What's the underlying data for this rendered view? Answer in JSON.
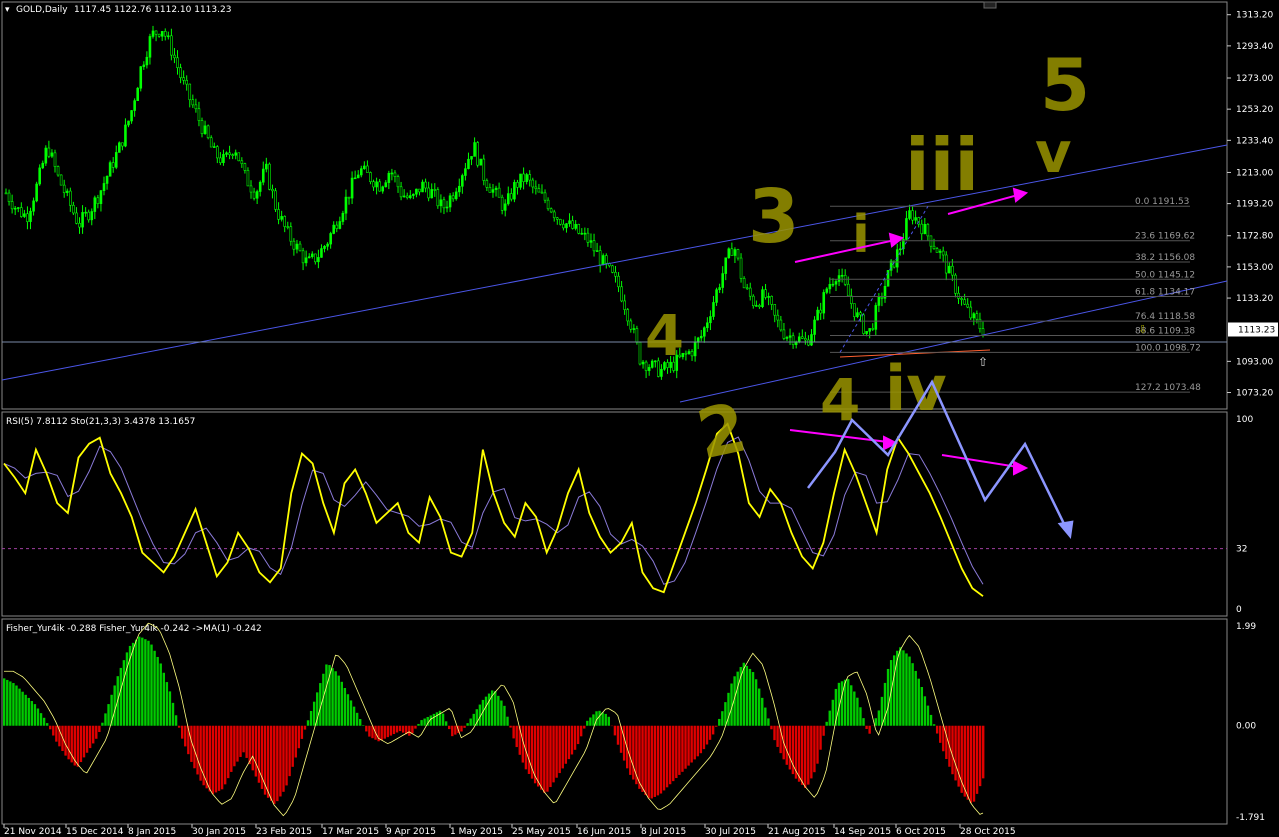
{
  "window": {
    "title": "GOLD,Daily",
    "ohlc": "1117.45 1122.76 1112.10 1113.23"
  },
  "colors": {
    "background": "#000000",
    "bull": "#00ff00",
    "bear": "#ff0000",
    "rsi": "#ffff00",
    "stoch": "#8a7ad8",
    "trendline": "#4b56e8",
    "annotation": "#9a9400",
    "arrow_magenta": "#ff00ff",
    "arrow_blue": "#8c96ff"
  },
  "price_axis": {
    "ticks": [
      "1313.20",
      "1293.40",
      "1273.00",
      "1253.20",
      "1233.40",
      "1213.00",
      "1193.20",
      "1172.80",
      "1153.00",
      "1133.20",
      "1113.23",
      "1093.00",
      "1073.20"
    ],
    "current": "1113.23"
  },
  "rsi_panel": {
    "label": "RSI(5) 7.8112  Sto(21,3,3) 3.4378 13.1657",
    "ticks": [
      "100",
      "32",
      "0"
    ]
  },
  "fisher_panel": {
    "label": "Fisher_Yur4ik -0.288  Fisher_Yur4ik -0.242  ->MA(1) -0.242",
    "ticks": [
      "1.99",
      "0.00",
      "-1.791"
    ]
  },
  "x_axis": {
    "labels": [
      "21 Nov 2014",
      "15 Dec 2014",
      "8 Jan 2015",
      "30 Jan 2015",
      "23 Feb 2015",
      "17 Mar 2015",
      "9 Apr 2015",
      "1 May 2015",
      "25 May 2015",
      "16 Jun 2015",
      "8 Jul 2015",
      "30 Jul 2015",
      "21 Aug 2015",
      "14 Sep 2015",
      "6 Oct 2015",
      "28 Oct 2015"
    ]
  },
  "fibonacci": [
    {
      "label": "0.0  1191.53"
    },
    {
      "label": "23.6  1169.62"
    },
    {
      "label": "38.2  1156.08"
    },
    {
      "label": "50.0  1145.12"
    },
    {
      "label": "61.8  1134.17"
    },
    {
      "label": "76.4  1118.58"
    },
    {
      "label": "88.6  1109.38"
    },
    {
      "label": "100.0  1098.72"
    },
    {
      "label": "127.2  1073.48"
    }
  ],
  "annotations": [
    "3",
    "i",
    "iii",
    "5",
    "v",
    "4",
    "2",
    "4",
    "iv"
  ],
  "chart_data": {
    "type": "candlestick",
    "title": "GOLD,Daily",
    "ylim": [
      1064,
      1320
    ],
    "x_labels": [
      "21 Nov 2014",
      "15 Dec 2014",
      "8 Jan 2015",
      "30 Jan 2015",
      "23 Feb 2015",
      "17 Mar 2015",
      "9 Apr 2015",
      "1 May 2015",
      "25 May 2015",
      "16 Jun 2015",
      "8 Jul 2015",
      "30 Jul 2015",
      "21 Aug 2015",
      "14 Sep 2015",
      "6 Oct 2015",
      "28 Oct 2015"
    ],
    "close_path": [
      1200,
      1190,
      1185,
      1205,
      1230,
      1210,
      1195,
      1180,
      1188,
      1200,
      1215,
      1230,
      1250,
      1280,
      1300,
      1305,
      1290,
      1270,
      1255,
      1240,
      1225,
      1220,
      1230,
      1210,
      1200,
      1215,
      1190,
      1175,
      1165,
      1155,
      1160,
      1170,
      1185,
      1200,
      1215,
      1210,
      1205,
      1215,
      1200,
      1195,
      1205,
      1200,
      1190,
      1200,
      1215,
      1230,
      1210,
      1200,
      1190,
      1205,
      1210,
      1200,
      1195,
      1185,
      1180,
      1175,
      1170,
      1160,
      1150,
      1140,
      1120,
      1095,
      1090,
      1087,
      1090,
      1095,
      1100,
      1110,
      1130,
      1150,
      1168,
      1140,
      1130,
      1135,
      1120,
      1110,
      1108,
      1105,
      1120,
      1140,
      1150,
      1135,
      1120,
      1110,
      1130,
      1150,
      1165,
      1188,
      1180,
      1170,
      1160,
      1145,
      1130,
      1120,
      1113
    ],
    "last": {
      "open": 1117.45,
      "high": 1122.76,
      "low": 1112.1,
      "close": 1113.23
    },
    "rsi_ylim": [
      0,
      100
    ],
    "rsi_level": 32,
    "rsi_last": 7.8112,
    "stoch_last": [
      3.4378,
      13.1657
    ],
    "fisher_ylim": [
      -1.791,
      1.99
    ],
    "fisher_last": [
      -0.288,
      -0.242
    ],
    "fisher_hist": [
      0.9,
      0.8,
      0.6,
      0.4,
      0.1,
      -0.3,
      -0.6,
      -0.8,
      -0.5,
      -0.2,
      0.4,
      1.0,
      1.5,
      1.7,
      1.6,
      1.2,
      0.6,
      -0.2,
      -0.7,
      -1.1,
      -1.3,
      -1.2,
      -0.8,
      -0.5,
      -0.9,
      -1.3,
      -1.5,
      -1.2,
      -0.6,
      0.0,
      0.6,
      1.2,
      1.0,
      0.6,
      0.2,
      -0.2,
      -0.3,
      -0.2,
      -0.1,
      -0.2,
      0.1,
      0.2,
      0.3,
      -0.2,
      -0.1,
      0.2,
      0.5,
      0.7,
      0.4,
      -0.3,
      -0.8,
      -1.1,
      -1.3,
      -1.0,
      -0.7,
      -0.4,
      0.1,
      0.3,
      0.2,
      -0.4,
      -0.9,
      -1.2,
      -1.4,
      -1.3,
      -1.1,
      -0.9,
      -0.7,
      -0.5,
      -0.2,
      0.3,
      0.9,
      1.2,
      1.0,
      0.4,
      -0.3,
      -0.7,
      -1.0,
      -1.2,
      -0.8,
      0.1,
      0.8,
      0.9,
      0.5,
      -0.2,
      0.3,
      1.2,
      1.5,
      1.3,
      0.8,
      0.2,
      -0.4,
      -0.9,
      -1.3,
      -1.5,
      -1.0
    ],
    "rsi_path": [
      75,
      68,
      60,
      82,
      70,
      55,
      50,
      78,
      85,
      88,
      70,
      60,
      48,
      30,
      25,
      20,
      28,
      40,
      52,
      35,
      18,
      25,
      40,
      32,
      20,
      15,
      22,
      60,
      80,
      75,
      55,
      40,
      65,
      72,
      60,
      45,
      50,
      55,
      40,
      35,
      58,
      48,
      30,
      28,
      40,
      82,
      60,
      45,
      38,
      55,
      48,
      30,
      42,
      60,
      72,
      50,
      38,
      30,
      35,
      45,
      20,
      12,
      10,
      25,
      40,
      55,
      72,
      90,
      95,
      80,
      55,
      48,
      62,
      55,
      40,
      28,
      22,
      35,
      60,
      82,
      70,
      55,
      40,
      72,
      88,
      80,
      70,
      60,
      48,
      35,
      22,
      12,
      8
    ]
  }
}
